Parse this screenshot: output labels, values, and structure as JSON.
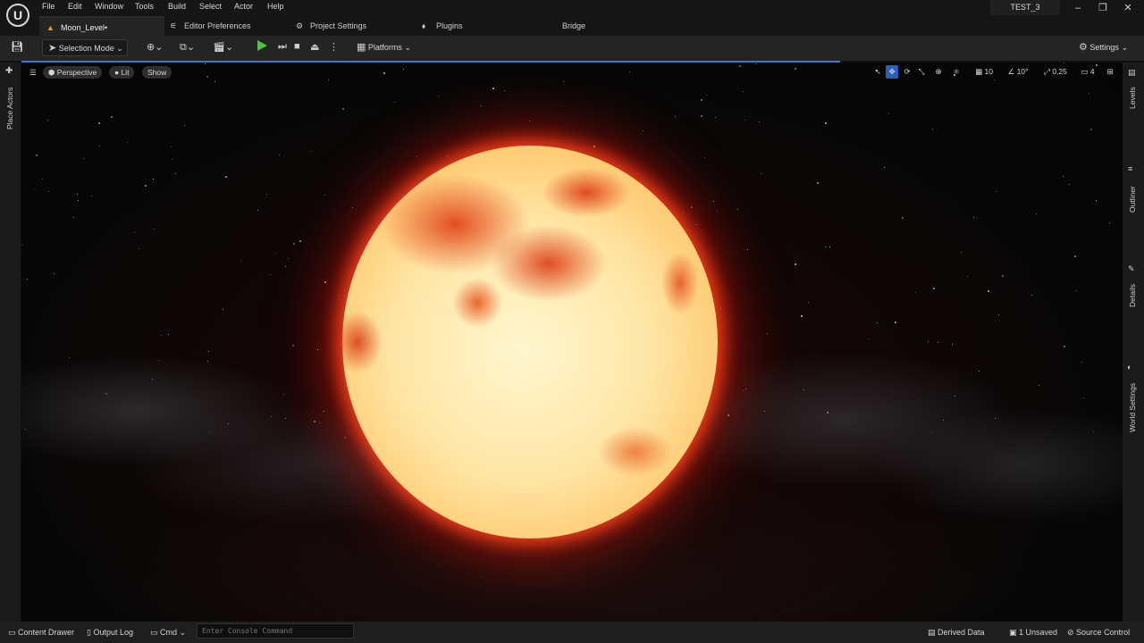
{
  "app": {
    "project_name": "TEST_3"
  },
  "menu": [
    "File",
    "Edit",
    "Window",
    "Tools",
    "Build",
    "Select",
    "Actor",
    "Help"
  ],
  "tabs": [
    {
      "label": "Moon_Level•",
      "active": true
    },
    {
      "label": "Editor Preferences",
      "active": false
    },
    {
      "label": "Project Settings",
      "active": false
    },
    {
      "label": "Plugins",
      "active": false
    },
    {
      "label": "Bridge",
      "active": false
    }
  ],
  "toolbar": {
    "selection_mode": "Selection Mode",
    "platforms": "Platforms",
    "settings": "Settings"
  },
  "viewport": {
    "perspective": "Perspective",
    "lit": "Lit",
    "show": "Show",
    "grid_value": "10",
    "angle_value": "10°",
    "scale_value": "0,25",
    "camera_speed": "4"
  },
  "left_panel": {
    "place_actors": "Place Actors"
  },
  "right_panels": [
    "Levels",
    "Outliner",
    "Details",
    "World Settings"
  ],
  "statusbar": {
    "content_drawer": "Content Drawer",
    "output_log": "Output Log",
    "cmd": "Cmd",
    "console_placeholder": "Enter Console Command",
    "derived_data": "Derived Data",
    "unsaved": "1 Unsaved",
    "source_control": "Source Control"
  },
  "colors": {
    "accent_blue": "#3a78d6",
    "play_green": "#4fc24a",
    "moon_glow": "#ff3a1a"
  }
}
